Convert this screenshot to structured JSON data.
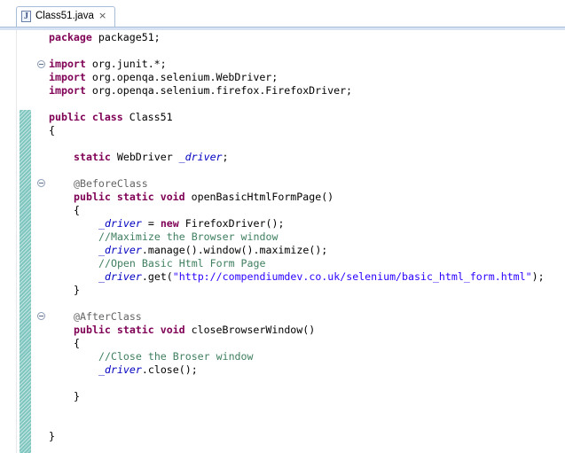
{
  "tab": {
    "title": "Class51.java",
    "close_glyph": "×"
  },
  "code": {
    "l1_kw": "package",
    "l1_rest": " package51;",
    "l2_kw": "import",
    "l2_rest": " org.junit.*;",
    "l3_kw": "import",
    "l3_rest": " org.openqa.selenium.WebDriver;",
    "l4_kw": "import",
    "l4_rest": " org.openqa.selenium.firefox.FirefoxDriver;",
    "l5_kw": "public class",
    "l5_rest": " Class51",
    "l6": "{",
    "l7_kw": "static",
    "l7_type": " WebDriver ",
    "l7_field": "_driver",
    "l7_end": ";",
    "l8_ann": "@BeforeClass",
    "l9_kw": "public static void",
    "l9_rest": " openBasicHtmlFormPage()",
    "l10": "{",
    "l11_field": "_driver",
    "l11_mid": " = ",
    "l11_kw": "new",
    "l11_rest": " FirefoxDriver();",
    "l12_cm": "//Maximize the Browser window",
    "l13_field": "_driver",
    "l13_rest": ".manage().window().maximize();",
    "l14_cm": "//Open Basic Html Form Page",
    "l15_field": "_driver",
    "l15_mid": ".get(",
    "l15_str": "\"http://compendiumdev.co.uk/selenium/basic_html_form.html\"",
    "l15_end": ");",
    "l16": "}",
    "l17_ann": "@AfterClass",
    "l18_kw": "public static void",
    "l18_rest": " closeBrowserWindow()",
    "l19": "{",
    "l20_cm": "//Close the Broser window",
    "l21_field": "_driver",
    "l21_rest": ".close();",
    "l22": "}",
    "l23": "}"
  }
}
